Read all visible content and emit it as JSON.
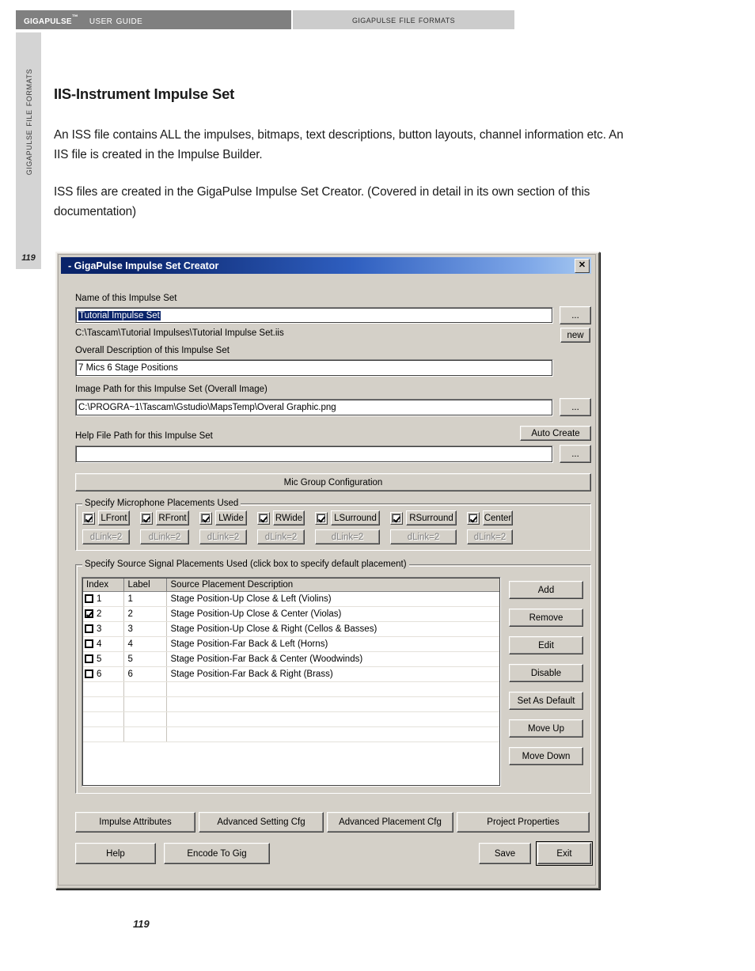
{
  "header": {
    "brand": "GigaPulse",
    "trademark": "™",
    "guide": "User Guide",
    "section_tab": "GigaPulse File Formats"
  },
  "sidebar": {
    "vertical_label": "GigaPulse File Formats",
    "page_number": "119"
  },
  "document": {
    "heading": "IIS-Instrument Impulse Set",
    "paragraphs": [
      "An ISS file contains ALL the impulses, bitmaps, text descriptions, button layouts, channel information etc.  An IIS file is created in the Impulse Builder.",
      "ISS files are created in the GigaPulse Impulse Set Creator.  (Covered in detail in its own section of this documentation)"
    ],
    "page_number": "119"
  },
  "dialog": {
    "title": "- GigaPulse Impulse Set Creator",
    "close_glyph": "✕",
    "fields": {
      "name_label": "Name of this Impulse Set",
      "name_value": "Tutorial Impulse Set",
      "name_browse": "...",
      "file_path": "C:\\Tascam\\Tutorial Impulses\\Tutorial Impulse Set.iis",
      "new_button": "new",
      "description_label": "Overall Description of this Impulse Set",
      "description_value": "7 Mics 6 Stage Positions",
      "image_path_label": "Image Path for this Impulse Set (Overall Image)",
      "image_path_value": "C:\\PROGRA~1\\Tascam\\Gstudio\\MapsTemp\\Overal Graphic.png",
      "image_browse": "...",
      "help_path_label": "Help File Path for this Impulse Set",
      "help_path_value": "",
      "help_browse": "...",
      "auto_create_button": "Auto Create"
    },
    "mic_group_button": "Mic Group Configuration",
    "mic_group": {
      "title": "Specify Microphone Placements Used",
      "sub_label": "dLink=2",
      "items": [
        {
          "label": "LFront",
          "checked": true
        },
        {
          "label": "RFront",
          "checked": true
        },
        {
          "label": "LWide",
          "checked": true
        },
        {
          "label": "RWide",
          "checked": true
        },
        {
          "label": "LSurround",
          "checked": true
        },
        {
          "label": "RSurround",
          "checked": true
        },
        {
          "label": "Center",
          "checked": true
        }
      ]
    },
    "source_group": {
      "title": "Specify Source Signal Placements Used (click box to specify default placement)",
      "columns": [
        "Index",
        "Label",
        "Source Placement Description"
      ],
      "rows": [
        {
          "checked": false,
          "index": "1",
          "label": "1",
          "description": "Stage Position-Up Close & Left  (Violins)"
        },
        {
          "checked": true,
          "index": "2",
          "label": "2",
          "description": "Stage Position-Up Close & Center  (Violas)"
        },
        {
          "checked": false,
          "index": "3",
          "label": "3",
          "description": "Stage Position-Up Close & Right  (Cellos & Basses)"
        },
        {
          "checked": false,
          "index": "4",
          "label": "4",
          "description": "Stage Position-Far Back & Left  (Horns)"
        },
        {
          "checked": false,
          "index": "5",
          "label": "5",
          "description": "Stage Position-Far Back & Center  (Woodwinds)"
        },
        {
          "checked": false,
          "index": "6",
          "label": "6",
          "description": "Stage Position-Far Back & Right  (Brass)"
        },
        {
          "checked": null,
          "index": "",
          "label": "",
          "description": ""
        },
        {
          "checked": null,
          "index": "",
          "label": "",
          "description": ""
        },
        {
          "checked": null,
          "index": "",
          "label": "",
          "description": ""
        },
        {
          "checked": null,
          "index": "",
          "label": "",
          "description": ""
        }
      ],
      "side_buttons": [
        "Add",
        "Remove",
        "Edit",
        "Disable",
        "Set As Default",
        "Move Up",
        "Move Down"
      ]
    },
    "bottom_row1": [
      "Impulse Attributes",
      "Advanced Setting Cfg",
      "Advanced Placement Cfg",
      "Project Properties"
    ],
    "bottom_row2_left": [
      "Help",
      "Encode To Gig"
    ],
    "bottom_row2_right": [
      "Save",
      "Exit"
    ]
  },
  "colors": {
    "title_bar_start": "#0a246a",
    "title_bar_end": "#a6c8f0",
    "dialog_face": "#d4d0c8",
    "header_band": "#808080",
    "header_tab": "#cccccc",
    "selection": "#0a246a"
  }
}
